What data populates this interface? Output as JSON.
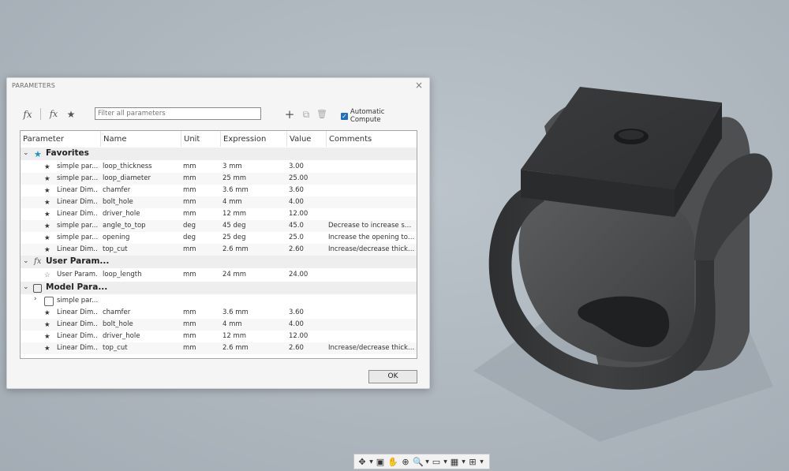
{
  "dialog": {
    "title": "PARAMETERS",
    "filter_placeholder": "Filter all parameters",
    "auto_compute_label": "Automatic Compute",
    "ok_label": "OK"
  },
  "columns": [
    "Parameter",
    "Name",
    "Unit",
    "Expression",
    "Value",
    "Comments"
  ],
  "groups": {
    "favorites": "Favorites",
    "user": "User Param...",
    "model": "Model Para..."
  },
  "favorites_rows": [
    {
      "param": "simple par...",
      "name": "loop_thickness",
      "unit": "mm",
      "expr": "3 mm",
      "value": "3.00",
      "comment": ""
    },
    {
      "param": "simple par...",
      "name": "loop_diameter",
      "unit": "mm",
      "expr": "25 mm",
      "value": "25.00",
      "comment": ""
    },
    {
      "param": "Linear Dim...",
      "name": "chamfer",
      "unit": "mm",
      "expr": "3.6 mm",
      "value": "3.60",
      "comment": ""
    },
    {
      "param": "Linear Dim...",
      "name": "bolt_hole",
      "unit": "mm",
      "expr": "4 mm",
      "value": "4.00",
      "comment": ""
    },
    {
      "param": "Linear Dim...",
      "name": "driver_hole",
      "unit": "mm",
      "expr": "12 mm",
      "value": "12.00",
      "comment": ""
    },
    {
      "param": "simple par...",
      "name": "angle_to_top",
      "unit": "deg",
      "expr": "45 deg",
      "value": "45.0",
      "comment": "Decrease to increase surf..."
    },
    {
      "param": "simple par...",
      "name": "opening",
      "unit": "deg",
      "expr": "25 deg",
      "value": "25.0",
      "comment": "Increase the opening to ..."
    },
    {
      "param": "Linear Dim...",
      "name": "top_cut",
      "unit": "mm",
      "expr": "2.6 mm",
      "value": "2.60",
      "comment": "Increase/decrease thickn..."
    }
  ],
  "user_rows": [
    {
      "param": "User Param...",
      "name": "loop_length",
      "unit": "mm",
      "expr": "24 mm",
      "value": "24.00",
      "comment": ""
    }
  ],
  "model_subgroup": "simple par...",
  "model_rows": [
    {
      "param": "Linear Dim...",
      "name": "chamfer",
      "unit": "mm",
      "expr": "3.6 mm",
      "value": "3.60",
      "comment": ""
    },
    {
      "param": "Linear Dim...",
      "name": "bolt_hole",
      "unit": "mm",
      "expr": "4 mm",
      "value": "4.00",
      "comment": ""
    },
    {
      "param": "Linear Dim...",
      "name": "driver_hole",
      "unit": "mm",
      "expr": "12 mm",
      "value": "12.00",
      "comment": ""
    },
    {
      "param": "Linear Dim...",
      "name": "top_cut",
      "unit": "mm",
      "expr": "2.6 mm",
      "value": "2.60",
      "comment": "Increase/decrease thickn..."
    }
  ],
  "icons": {
    "fx": "fx",
    "star": "★",
    "star_hollow": "☆",
    "add": "+",
    "copy": "⧉",
    "delete": "🗑",
    "close": "×"
  },
  "colors": {
    "accent": "#1d90d0",
    "checkbox": "#1f6fc0",
    "viewport_bg": "#aeb6be",
    "model_dark": "#3a3b3c"
  }
}
